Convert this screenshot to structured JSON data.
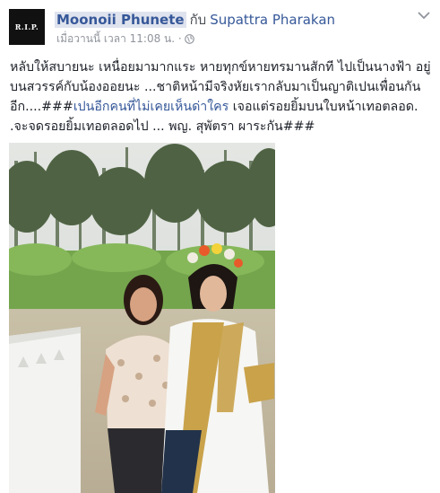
{
  "avatar": {
    "label": "R.I.P."
  },
  "header": {
    "author": "Moonoii Phunete",
    "with_word": "กับ",
    "tagged": "Supattra Pharakan"
  },
  "meta": {
    "time": "เมื่อวานนี้ เวลา 11:08 น. ·"
  },
  "post": {
    "text_part1": "หลับให้สบายนะ เหนื่อยมามากแระ หายทุกข์หายทรมานสักที ไปเป็นนางฟ้า อยู่บนสวรรค์กับน้องออยนะ ...ชาติหน้ามีจริงหัยเรากลับมาเป็นญาติเปนเพื่อนกันอีก....###",
    "text_highlight": "เปนอีกคนที่ไม่เคยเห็นด่าใคร",
    "text_part2": " เจอแต่รอยยิ้มบนใบหน้าเทอตลอด. .จะจดรอยยิ้มเทอตลอดไป ... พญ. สุพัตรา ผาระกัน###"
  },
  "colors": {
    "link": "#365899",
    "meta": "#90949c",
    "text": "#1d2129"
  }
}
